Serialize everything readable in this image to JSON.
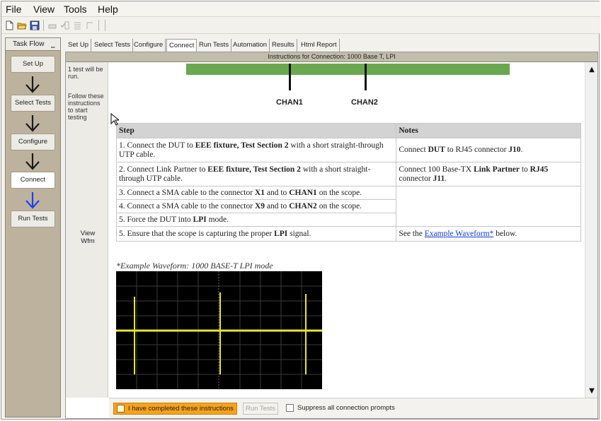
{
  "menubar": {
    "items": [
      "File",
      "View",
      "Tools",
      "Help"
    ]
  },
  "toolbar": {
    "icons": [
      "new-file-icon",
      "open-folder-icon",
      "save-icon",
      "disabled-tool-icon",
      "checklist-icon",
      "list-icon",
      "step-icon"
    ]
  },
  "taskflow": {
    "header": "Task Flow",
    "min_glyph": "_",
    "steps": [
      "Set Up",
      "Select Tests",
      "Configure",
      "Connect",
      "Run Tests"
    ],
    "active_step": "Connect",
    "arrow_color": "#1a1a1a",
    "active_arrow_color": "#1f3ff0"
  },
  "tabs": [
    "Set Up",
    "Select Tests",
    "Configure",
    "Connect",
    "Run Tests",
    "Automation",
    "Results",
    "Html Report"
  ],
  "active_tab": "Connect",
  "main": {
    "title": "Instructions for Connection: 1000 Base T, LPI",
    "side_note_1": [
      "1 test will be",
      "run."
    ],
    "side_note_2": [
      "Follow these",
      "instructions",
      "to start",
      "testing"
    ],
    "view_wfm": [
      "View",
      "Wfm"
    ]
  },
  "diagram": {
    "chan1": "CHAN1",
    "chan2": "CHAN2",
    "fixture_color": "#6aa84f"
  },
  "table": {
    "headers": [
      "Step",
      "Notes"
    ],
    "rows": [
      {
        "step": [
          "1. Connect the DUT to ",
          "EEE fixture, Test Section 2",
          " with a short straight-through UTP cable."
        ],
        "note": [
          "Connect ",
          "DUT",
          " to RJ45 connector ",
          "J10",
          "."
        ]
      },
      {
        "step": [
          "2. Connect Link Partner to ",
          "EEE fixture, Test Section 2",
          " with a short straight-through UTP cable."
        ],
        "note": [
          "Connect 100 Base-TX ",
          "Link Partner",
          " to ",
          "RJ45",
          " connector ",
          "J11",
          "."
        ]
      },
      {
        "step": [
          "3. Connect a SMA cable to the connector ",
          "X1",
          " and to ",
          "CHAN1",
          " on the scope."
        ]
      },
      {
        "step": [
          "4. Connect a SMA cable to the connector ",
          "X9",
          " and to ",
          "CHAN2",
          " on the scope."
        ]
      },
      {
        "step": [
          "5. Force the DUT into ",
          "LPI",
          " mode."
        ]
      },
      {
        "step": [
          "5. Ensure that the scope is capturing the proper ",
          "LPI",
          " signal."
        ],
        "note": [
          "See the ",
          "Example Waveform*",
          " below."
        ]
      }
    ]
  },
  "waveform": {
    "caption": "*Example Waveform: 1000 BASE-T LPI mode",
    "trace_color": "#e6e62a"
  },
  "bottom": {
    "done_label": "I have completed these instructions",
    "run_label": "Run Tests",
    "suppress_label": "Suppress all connection prompts",
    "done_color": "#f7a21b"
  }
}
